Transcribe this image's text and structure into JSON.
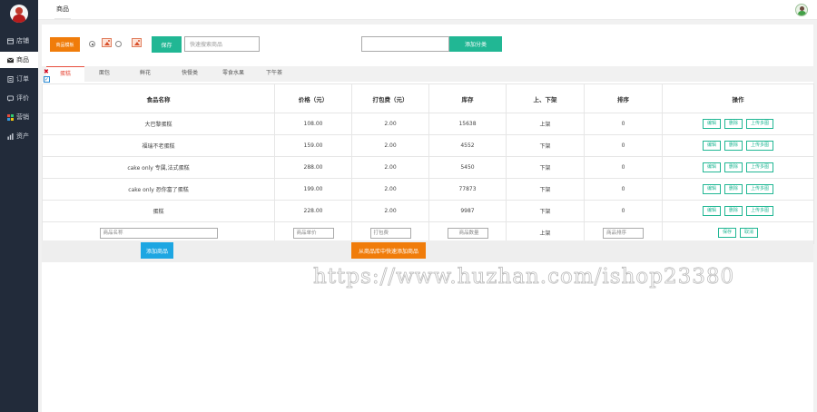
{
  "sidebar": {
    "items": [
      {
        "label": "店铺",
        "icon": "store-icon"
      },
      {
        "label": "商品",
        "icon": "goods-icon",
        "active": true
      },
      {
        "label": "订单",
        "icon": "order-icon"
      },
      {
        "label": "评价",
        "icon": "review-icon"
      },
      {
        "label": "营销",
        "icon": "marketing-icon"
      },
      {
        "label": "资产",
        "icon": "assets-icon"
      }
    ]
  },
  "topbar": {
    "tab": "商品"
  },
  "toolbar": {
    "mode_button": "商品模板",
    "save_button": "保存",
    "search_placeholder": "快速搜索商品",
    "category_input": "",
    "add_category_button": "添加分类"
  },
  "tabs": [
    "蛋糕",
    "面包",
    "鲜花",
    "快餐类",
    "零食水果",
    "下午茶"
  ],
  "table": {
    "headers": [
      "食品名称",
      "价格（元）",
      "打包费（元）",
      "库存",
      "上、下架",
      "排序",
      "操作"
    ],
    "rows": [
      {
        "name": "大巴黎蛋糕",
        "price": "108.00",
        "pack": "2.00",
        "stock": "15638",
        "status": "上架",
        "sort": "0"
      },
      {
        "name": "福瑞不老蛋糕",
        "price": "159.00",
        "pack": "2.00",
        "stock": "4552",
        "status": "下架",
        "sort": "0"
      },
      {
        "name": "cake only 专属,法式蛋糕",
        "price": "288.00",
        "pack": "2.00",
        "stock": "5450",
        "status": "下架",
        "sort": "0"
      },
      {
        "name": "cake only 恐你富了蛋糕",
        "price": "199.00",
        "pack": "2.00",
        "stock": "77873",
        "status": "下架",
        "sort": "0"
      },
      {
        "name": "蛋糕",
        "price": "228.00",
        "pack": "2.00",
        "stock": "9987",
        "status": "下架",
        "sort": "0"
      }
    ],
    "ops": {
      "edit": "编辑",
      "delete": "删除",
      "upload": "上传多图"
    },
    "new_row": {
      "name_placeholder": "商品名称",
      "price_placeholder": "商品单价",
      "pack_placeholder": "打包费",
      "stock_placeholder": "商品数量",
      "status": "上架",
      "sort_placeholder": "商品排序",
      "save": "保存",
      "cancel": "取消"
    }
  },
  "bottom": {
    "add_goods": "添加商品",
    "quick_add": "从商品库中快速添加商品"
  },
  "watermark": "https://www.huzhan.com/ishop23380"
}
